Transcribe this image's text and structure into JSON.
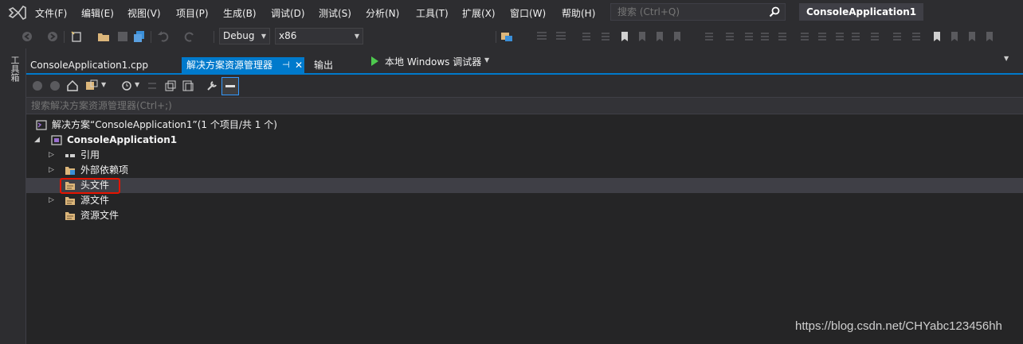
{
  "menu": [
    "文件(F)",
    "编辑(E)",
    "视图(V)",
    "项目(P)",
    "生成(B)",
    "调试(D)",
    "测试(S)",
    "分析(N)",
    "工具(T)",
    "扩展(X)",
    "窗口(W)",
    "帮助(H)"
  ],
  "search": {
    "placeholder": "搜索 (Ctrl+Q)"
  },
  "project_title": "ConsoleApplication1",
  "toolbar": {
    "config": "Debug",
    "platform": "x86",
    "run_label": "本地 Windows 调试器"
  },
  "toolbox_label": "工具箱",
  "tabs": {
    "file": "ConsoleApplication1.cpp",
    "explorer": "解决方案资源管理器",
    "output": "输出",
    "pin": "⊣",
    "close": "✕"
  },
  "explorer": {
    "search_placeholder": "搜索解决方案资源管理器(Ctrl+;)",
    "solution": "解决方案“ConsoleApplication1”(1 个项目/共 1 个)",
    "project": "ConsoleApplication1",
    "nodes": [
      "引用",
      "外部依赖项",
      "头文件",
      "源文件",
      "资源文件"
    ]
  },
  "watermark": "https://blog.csdn.net/CHYabc123456hh",
  "colors": {
    "accent": "#007acc",
    "highlight": "#e51400",
    "folder": "#dcb67a"
  }
}
